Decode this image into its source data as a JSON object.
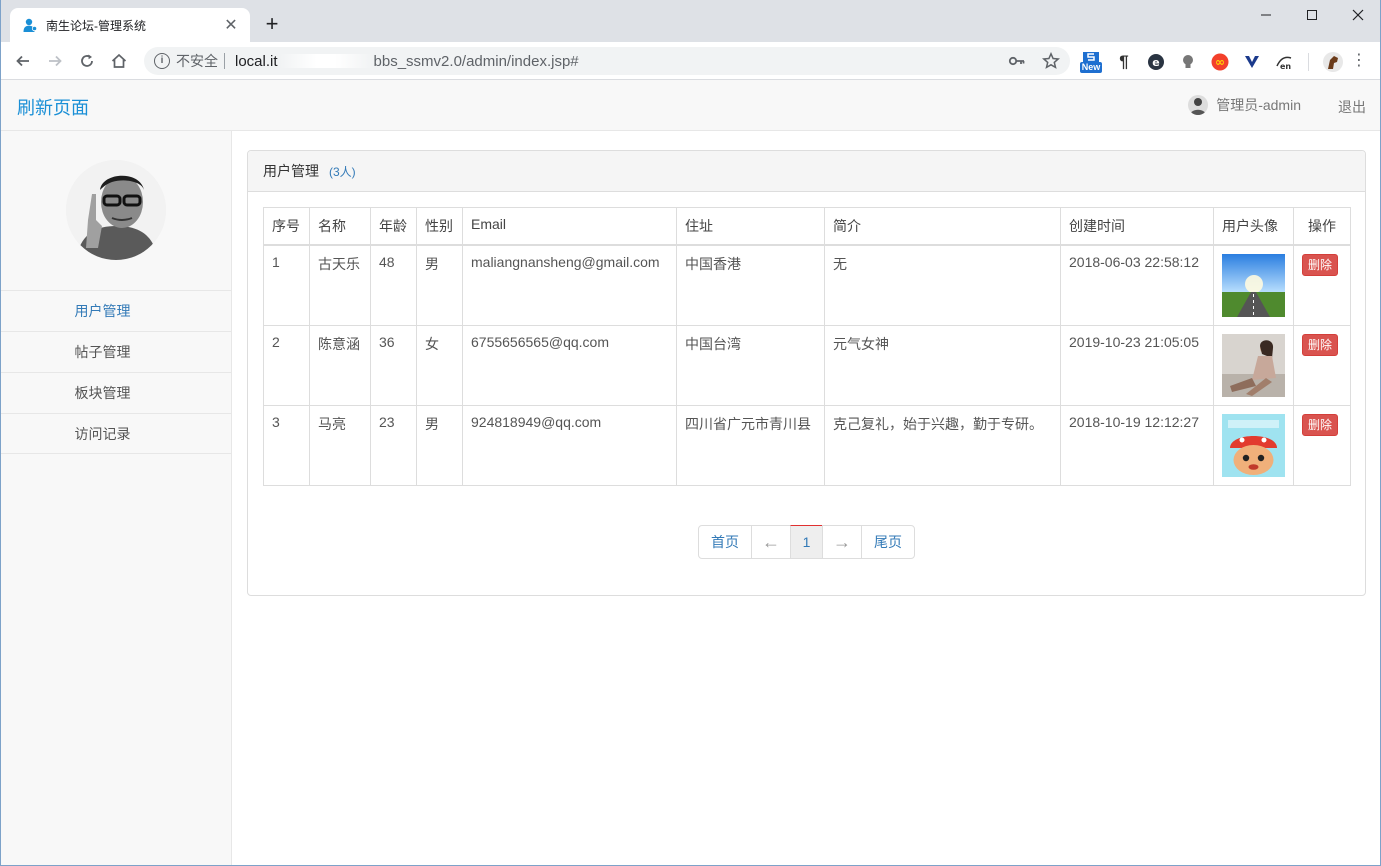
{
  "browser": {
    "tab_title": "南生论坛-管理系统",
    "security_label": "不安全",
    "url_host": "local.it",
    "url_path": "bbs_ssmv2.0/admin/index.jsp#",
    "ext_new_badge": "New"
  },
  "header": {
    "brand": "刷新页面",
    "admin_name": "管理员-admin",
    "logout": "退出"
  },
  "sidebar": {
    "items": [
      {
        "label": "用户管理",
        "active": true
      },
      {
        "label": "帖子管理",
        "active": false
      },
      {
        "label": "板块管理",
        "active": false
      },
      {
        "label": "访问记录",
        "active": false
      }
    ]
  },
  "panel": {
    "title": "用户管理",
    "count": "(3人)"
  },
  "table": {
    "headers": {
      "index": "序号",
      "name": "名称",
      "age": "年龄",
      "gender": "性别",
      "email": "Email",
      "address": "住址",
      "bio": "简介",
      "created": "创建时间",
      "avatar": "用户头像",
      "action": "操作"
    },
    "delete_label": "删除",
    "rows": [
      {
        "index": "1",
        "name": "古天乐",
        "age": "48",
        "gender": "男",
        "email": "maliangnansheng@gmail.com",
        "address": "中国香港",
        "bio": "无",
        "created": "2018-06-03 22:58:12"
      },
      {
        "index": "2",
        "name": "陈意涵",
        "age": "36",
        "gender": "女",
        "email": "6755656565@qq.com",
        "address": "中国台湾",
        "bio": "元气女神",
        "created": "2019-10-23 21:05:05"
      },
      {
        "index": "3",
        "name": "马亮",
        "age": "23",
        "gender": "男",
        "email": "924818949@qq.com",
        "address": "四川省广元市青川县",
        "bio": "克己复礼，始于兴趣，勤于专研。",
        "created": "2018-10-19 12:12:27"
      }
    ]
  },
  "pager": {
    "first": "首页",
    "prev": "←",
    "current": "1",
    "next": "→",
    "last": "尾页"
  },
  "colors": {
    "brand": "#1a8fd6",
    "link": "#337ab7",
    "danger": "#d9534f",
    "sidebar_bg": "#f8f8f8"
  }
}
